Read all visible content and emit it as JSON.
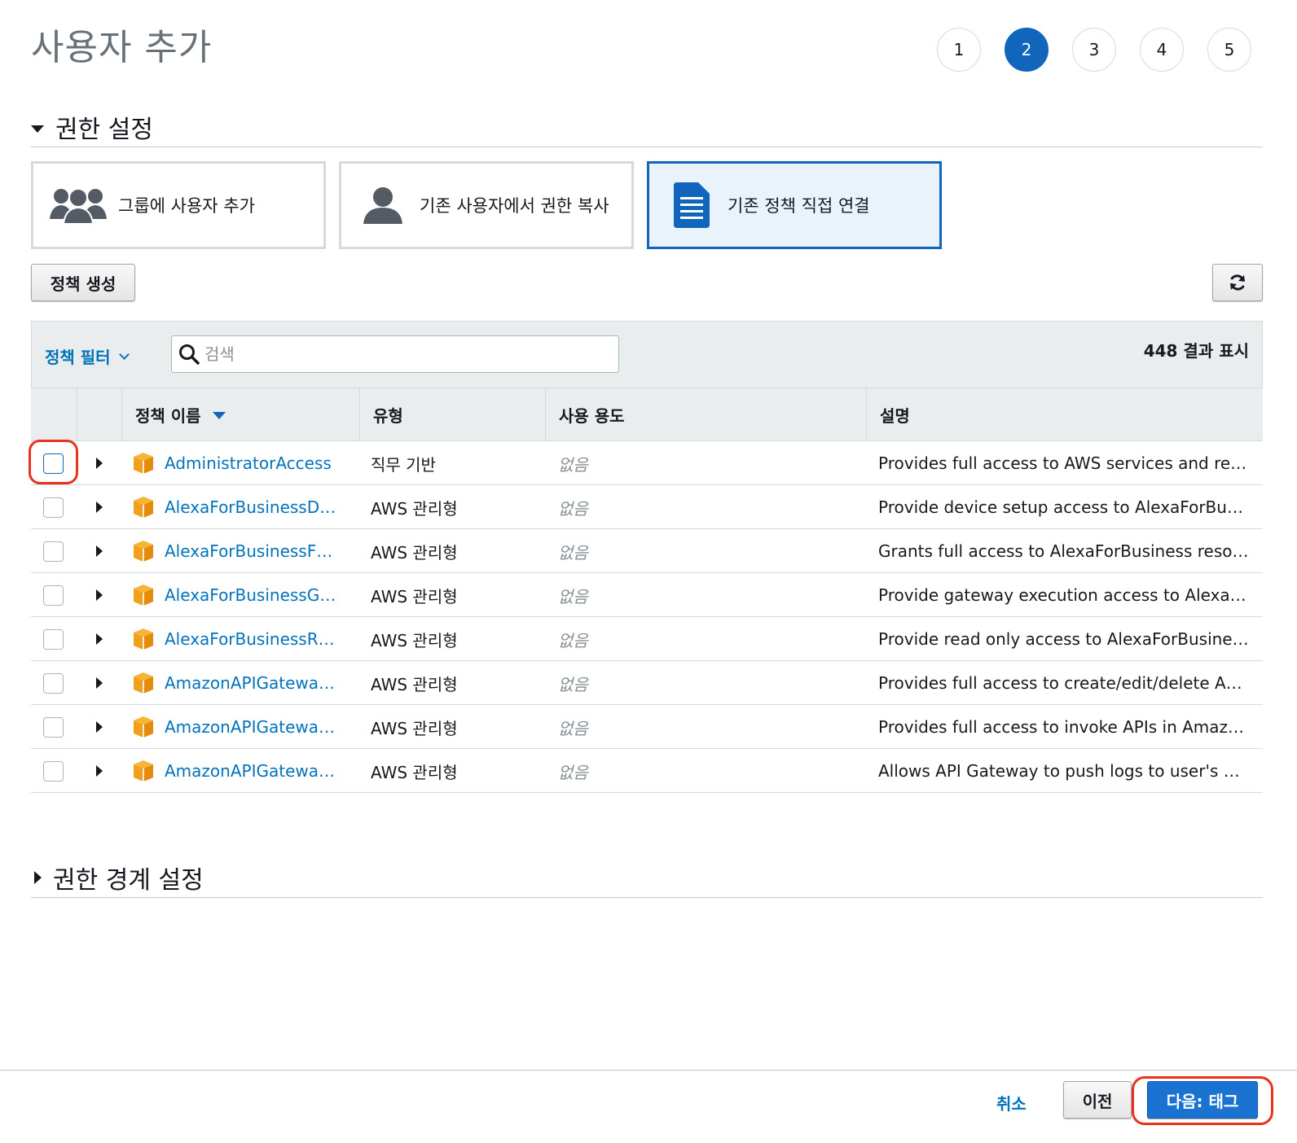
{
  "page": {
    "title": "사용자 추가"
  },
  "steps": [
    "1",
    "2",
    "3",
    "4",
    "5"
  ],
  "active_step": "2",
  "permissions_section": {
    "title": "권한 설정"
  },
  "options": [
    {
      "label": "그룹에 사용자 추가",
      "icon": "group-icon",
      "selected": false
    },
    {
      "label": "기존 사용자에서 권한 복사",
      "icon": "user-icon",
      "selected": false
    },
    {
      "label": "기존 정책 직접 연결",
      "icon": "document-icon",
      "selected": true
    }
  ],
  "toolbar": {
    "create_policy_label": "정책 생성",
    "refresh_icon": "refresh-icon",
    "filter_label": "정책 필터",
    "search_placeholder": "검색",
    "results_count": "448 결과 표시"
  },
  "table": {
    "columns": [
      "정책 이름",
      "유형",
      "사용 용도",
      "설명"
    ],
    "rows": [
      {
        "name": "AdministratorAccess",
        "type": "직무 기반",
        "usage": "없음",
        "description": "Provides full access to AWS services and re…"
      },
      {
        "name": "AlexaForBusinessD…",
        "type": "AWS 관리형",
        "usage": "없음",
        "description": "Provide device setup access to AlexaForBu…"
      },
      {
        "name": "AlexaForBusinessF…",
        "type": "AWS 관리형",
        "usage": "없음",
        "description": "Grants full access to AlexaForBusiness reso…"
      },
      {
        "name": "AlexaForBusinessG…",
        "type": "AWS 관리형",
        "usage": "없음",
        "description": "Provide gateway execution access to Alexa…"
      },
      {
        "name": "AlexaForBusinessR…",
        "type": "AWS 관리형",
        "usage": "없음",
        "description": "Provide read only access to AlexaForBusine…"
      },
      {
        "name": "AmazonAPIGatewa…",
        "type": "AWS 관리형",
        "usage": "없음",
        "description": "Provides full access to create/edit/delete A…"
      },
      {
        "name": "AmazonAPIGatewa…",
        "type": "AWS 관리형",
        "usage": "없음",
        "description": "Provides full access to invoke APIs in Amaz…"
      },
      {
        "name": "AmazonAPIGatewa…",
        "type": "AWS 관리형",
        "usage": "없음",
        "description": "Allows API Gateway to push logs to user's …"
      }
    ]
  },
  "boundary_section": {
    "title": "권한 경계 설정"
  },
  "footer": {
    "cancel_label": "취소",
    "previous_label": "이전",
    "next_label": "다음: 태그"
  },
  "colors": {
    "accent": "#1166bb",
    "link": "#0073bb",
    "highlight": "#e8321e",
    "policy_icon": "#f0a01c"
  }
}
